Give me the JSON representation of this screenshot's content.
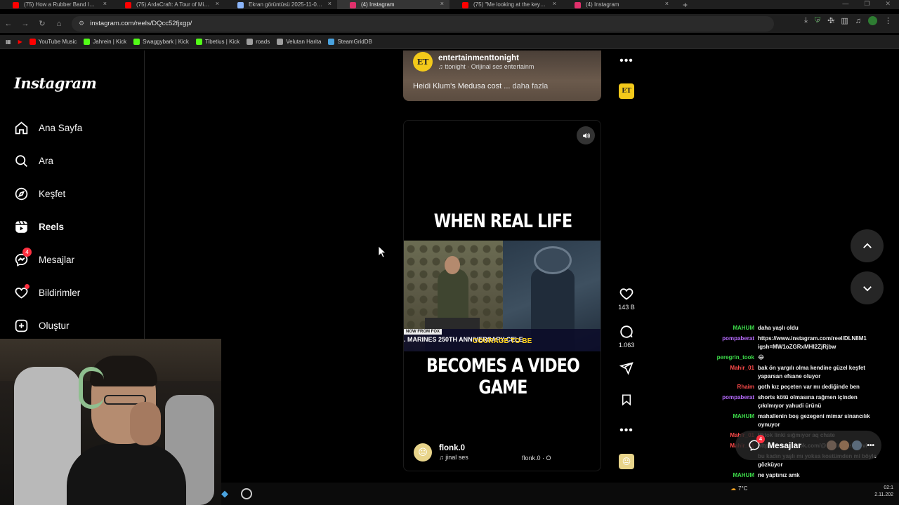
{
  "browser": {
    "tabs": [
      {
        "label": "(75) How a Rubber Band Improv",
        "color": "#ff0000",
        "active": false
      },
      {
        "label": "(75) ArdaCraft: A Tour of Middle",
        "color": "#ff0000",
        "active": false
      },
      {
        "label": "Ekran görüntüsü 2025-11-01 21",
        "color": "#8ab4f8",
        "active": false
      },
      {
        "label": "(4) Instagram",
        "color": "#e1306c",
        "active": true
      },
      {
        "label": "(75) \"Me looking at the keychai",
        "color": "#ff0000",
        "active": false
      },
      {
        "label": "(4) Instagram",
        "color": "#e1306c",
        "active": false
      }
    ],
    "url": "instagram.com/reels/DQcc52fjxgp/",
    "bookmarks": [
      {
        "label": "YouTube Music",
        "color": "#ff0000"
      },
      {
        "label": "Jahrein | Kick",
        "color": "#53fc18"
      },
      {
        "label": "Swaggybark | Kick",
        "color": "#53fc18"
      },
      {
        "label": "Tibetius | Kick",
        "color": "#53fc18"
      },
      {
        "label": "roads",
        "color": "#9e9e9e"
      },
      {
        "label": "Velutan Harita",
        "color": "#9e9e9e"
      },
      {
        "label": "SteamGridDB",
        "color": "#4aa3df"
      }
    ]
  },
  "instagram": {
    "logo": "Instagram",
    "nav": [
      {
        "label": "Ana Sayfa",
        "icon": "home-icon"
      },
      {
        "label": "Ara",
        "icon": "search-icon"
      },
      {
        "label": "Keşfet",
        "icon": "explore-icon"
      },
      {
        "label": "Reels",
        "icon": "reels-icon"
      },
      {
        "label": "Mesajlar",
        "icon": "messenger-icon",
        "badge": "4"
      },
      {
        "label": "Bildirimler",
        "icon": "heart-icon"
      },
      {
        "label": "Oluştur",
        "icon": "plus-icon"
      }
    ]
  },
  "reel_prev": {
    "avatar": "ET",
    "username": "entertainmenttonight",
    "audio": "ttonight · Orijinal ses  entertainm",
    "caption": "Heidi Klum's Medusa cost ...",
    "more": "daha fazla"
  },
  "reel_main": {
    "headline_top": "WHEN REAL LIFE",
    "headline_bottom": "BECOMES A VIDEO GAME",
    "news_tag": "NOW FROM FOX",
    "news_text": ". MARINES 250TH ANNIVERSARY CELE",
    "overlay_caption": "COURAGE TO BE",
    "username": "flonk.0",
    "audio": "jinal ses",
    "audio_tag": "flonk.0 · O",
    "likes": "143 B",
    "comments": "1.063"
  },
  "chat": [
    {
      "user": "MAHUM",
      "text": "daha yaşlı oldu",
      "color": "#3ddc4a"
    },
    {
      "user": "pompaberat",
      "text": "https://www.instagram.com/reel/DLN8M1 igsh=MW1oZGRxMHI2ZjRjbw",
      "color": "#b86cff"
    },
    {
      "user": "peregrin_took",
      "text": "😂",
      "color": "#3ddc4a"
    },
    {
      "user": "Mahir_01",
      "text": "bak ön yargılı olma kendine güzel keşfet yaparsan efsane oluyor",
      "color": "#ff4b4b"
    },
    {
      "user": "Rhaim",
      "text": "goth kız peçeten var mı dediğinde ben",
      "color": "#ff4b4b"
    },
    {
      "user": "pompaberat",
      "text": "shorts kötü olmasına rağmen içinden çıkılmıyor yahudi ürünü",
      "color": "#b86cff"
    },
    {
      "user": "MAHUM",
      "text": "mahallenin boş gezegeni mimar sinancılık oynuyor",
      "color": "#3ddc4a"
    },
    {
      "user": "Mahir_01",
      "text": "tiktok linki sığmıyor aq chate",
      "color": "#ff4b4b"
    },
    {
      "user": "Mahir_01",
      "text": "https://www.tiktok.com/@soulmatefilm/vi",
      "color": "#ff4b4b"
    },
    {
      "user": "",
      "text": "bu kadın yaşlı mı yoksa kostümden mi böyle gözküyor",
      "color": "#3ddc4a"
    },
    {
      "user": "MAHUM",
      "text": "ne yaptınız amk",
      "color": "#3ddc4a"
    }
  ],
  "messages_pill": {
    "label": "Mesajlar",
    "badge": "4"
  },
  "taskbar": {
    "temp": "7°C",
    "time": "02:1",
    "date": "2.11.202"
  }
}
